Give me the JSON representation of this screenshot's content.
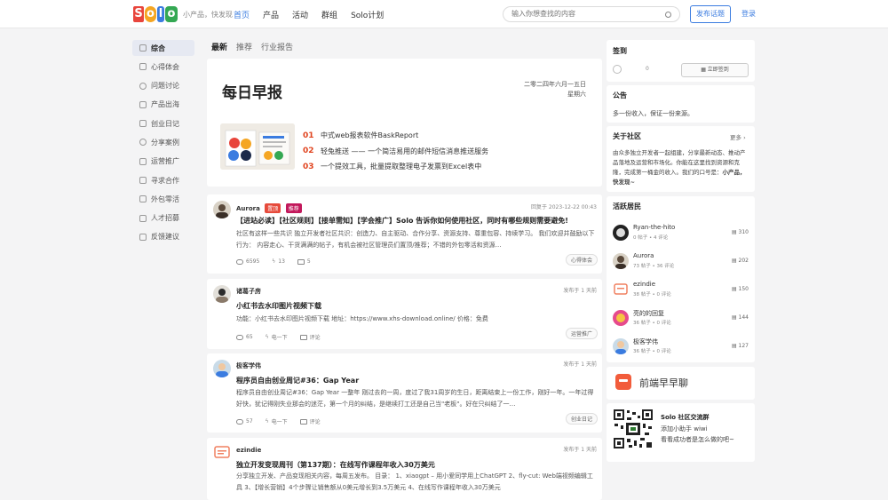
{
  "header": {
    "logo_letters": [
      "S",
      "o",
      "l",
      "o"
    ],
    "tagline": "小产品，快发现",
    "nav": [
      "首页",
      "产品",
      "活动",
      "群组",
      "Solo计划"
    ],
    "search_placeholder": "输入你想查找的内容",
    "post_button": "发布话题",
    "login": "登录"
  },
  "sidebar": {
    "items": [
      "综合",
      "心得体会",
      "问题讨论",
      "产品出海",
      "创业日记",
      "分享案例",
      "运营推广",
      "寻求合作",
      "外包零活",
      "人才招募",
      "反馈建议"
    ]
  },
  "feed_tabs": [
    "最新",
    "推荐",
    "行业报告"
  ],
  "daily": {
    "title": "每日早报",
    "date": "二零二四年六月一五日",
    "weekday": "星期六",
    "items": [
      {
        "num": "01",
        "text": "中式web报表软件BaskReport"
      },
      {
        "num": "02",
        "text": "轻兔推送 —— 一个简洁易用的邮件短信消息推送服务"
      },
      {
        "num": "03",
        "text": "一个提效工具，批量提取整理电子发票到Excel表中"
      }
    ]
  },
  "posts": [
    {
      "author": "Aurora",
      "tags": [
        "置顶",
        "推荐"
      ],
      "time": "回复于 2023-12-22 00:43",
      "title": "【进站必读】【社区规则】【接单需知】【学会推广】Solo 告诉你如何使用社区，同时有哪些规则需要避免!",
      "body": "社区有这样一些共识 独立开发者社区共识：创造力、自主驱动、合作分享、资源支持、尊重包容、持续学习。 我们欢迎并鼓励以下行为： 内容走心、干货满满的帖子，有机会被社区管理员们置顶/推荐；不错的外包零活和资源…",
      "views": "6595",
      "likes": "13",
      "comments": "5",
      "category": "心得体会"
    },
    {
      "author": "诸葛子房",
      "tags": [],
      "time": "发布于 1 天前",
      "title": "小红书去水印图片视频下载",
      "body": "功能：小红书去水印图片视频下载 地址：https://www.xhs-download.online/ 价格：免费",
      "views": "65",
      "likes": "电一下",
      "comments": "评论",
      "category": "运营推广"
    },
    {
      "author": "极客学伟",
      "tags": [],
      "time": "发布于 1 天前",
      "title": "程序员自由创业周记#36：Gap Year",
      "body": "程序员自由创业周记#36：Gap Year 一整年 刚过去的一周，度过了我31周岁的生日，距离结束上一份工作，刚好一年。一年过得好快，犹记得刚失业那会的迷茫，第一个月的纠结，是继续打工还是自己当\"老板\"。好在只纠结了一…",
      "views": "57",
      "likes": "电一下",
      "comments": "评论",
      "category": "创业日记"
    },
    {
      "author": "ezindie",
      "tags": [],
      "time": "发布于 1 天前",
      "title": "独立开发变现周刊（第137期）：在线写作课程年收入30万美元",
      "body": "分享独立开发、产品变现相关内容，每周五发布。 目录： 1、xiaogpt – 用小爱同学用上ChatGPT 2、fly-cut: Web端视频编辑工具 3、【增长营销】4个步骤让销售额从0美元增长到3.5万美元 4、在线写作课程年收入30万美元"
    }
  ],
  "signin": {
    "title": "签到",
    "count": "0",
    "button": "立即签到"
  },
  "announcement": {
    "title": "公告",
    "text": "多一份收入，保证一份来源。"
  },
  "about": {
    "title": "关于社区",
    "more": "更多",
    "text": "由众多独立开发者一起组建，分享最新动态、推动产品落地及运营和市场化。你能在这里找到资源和克隆，完成第一桶金的收入。我们的口号是：",
    "slogan": "小产品，快发现~"
  },
  "active_members": {
    "title": "活跃居民",
    "members": [
      {
        "name": "Ryan-the-hito",
        "meta": "0 帖子 • 4 评论",
        "count": "310"
      },
      {
        "name": "Aurora",
        "meta": "73 帖子 • 36 评论",
        "count": "202"
      },
      {
        "name": "ezindie",
        "meta": "38 帖子 • 0 评论",
        "count": "150"
      },
      {
        "name": "亮的的回复",
        "meta": "36 帖子 • 0 评论",
        "count": "144"
      },
      {
        "name": "极客学伟",
        "meta": "36 帖子 • 0 评论",
        "count": "127"
      }
    ]
  },
  "banner": {
    "text": "前端早早聊"
  },
  "group": {
    "title": "Solo 社区交流群",
    "line1": "添加小助手 wiwi",
    "line2": "看看成功者是怎么做的吧~"
  },
  "colors": {
    "accent": "#3b7ce0",
    "hot": "#e0441f",
    "tag_pin": "#e64a3b",
    "tag_rec": "#c2185b"
  }
}
